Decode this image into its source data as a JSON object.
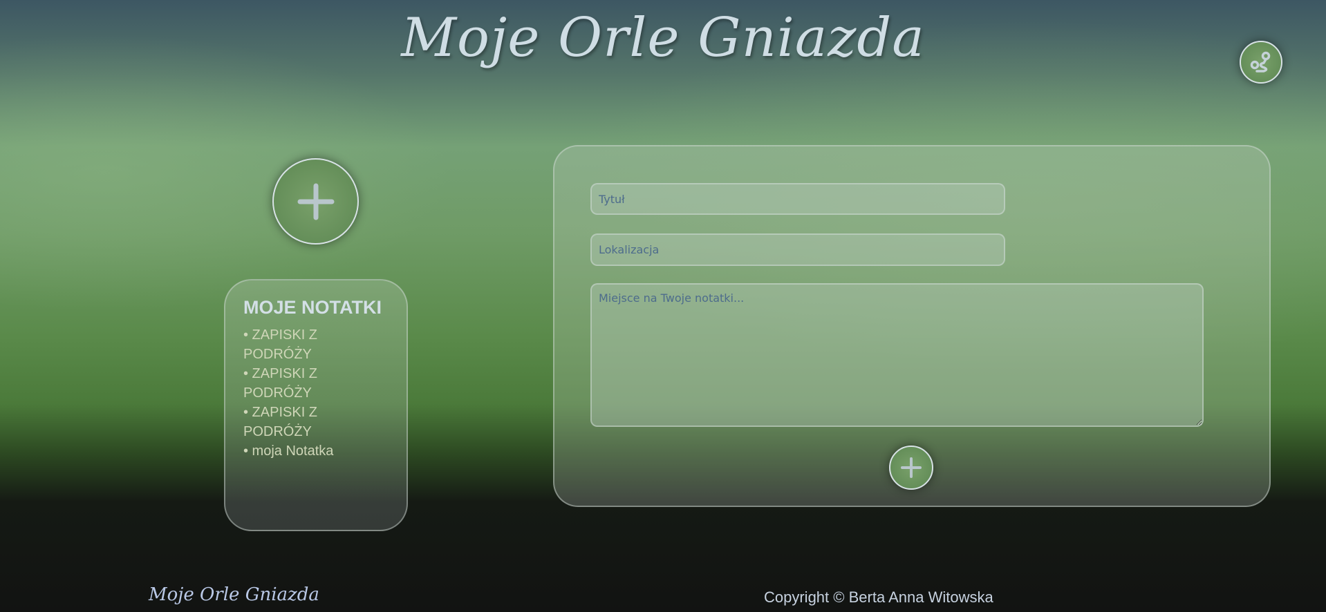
{
  "header": {
    "title": "Moje Orle Gniazda",
    "route_icon": "route-icon"
  },
  "add_button_icon": "plus-icon",
  "notes": {
    "heading": "MOJE NOTATKI",
    "items": [
      "• ZAPISKI Z PODRÓŻY",
      "• ZAPISKI Z PODRÓŻY",
      "• ZAPISKI Z PODRÓŻY",
      "• moja Notatka"
    ]
  },
  "form": {
    "title_placeholder": "Tytuł",
    "location_placeholder": "Lokalizacja",
    "notes_placeholder": "Miejsce na Twoje notatki...",
    "submit_icon": "plus-icon"
  },
  "footer": {
    "logo": "Moje Orle Gniazda",
    "copyright": "Copyright © Berta Anna Witowska"
  }
}
